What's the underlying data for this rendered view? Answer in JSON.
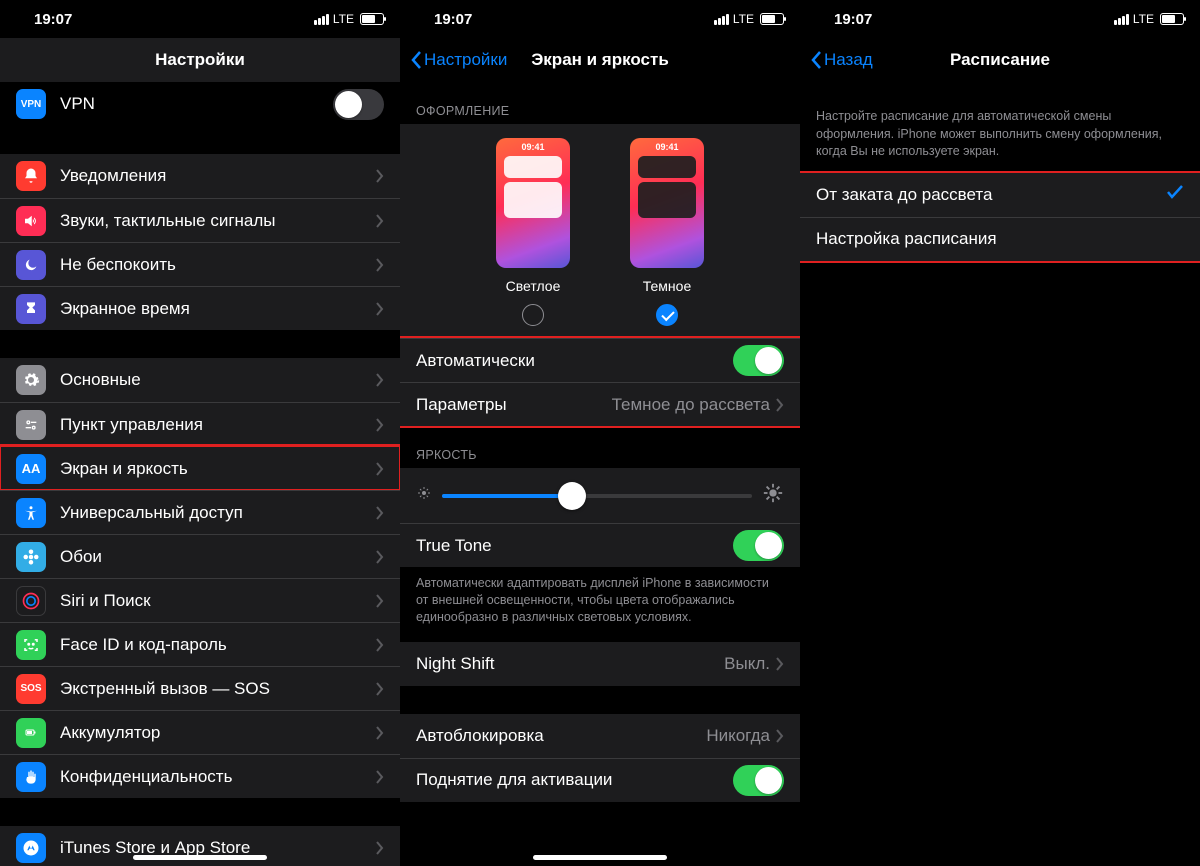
{
  "statusbar": {
    "time": "19:07",
    "network": "LTE"
  },
  "screen1": {
    "title": "Настройки",
    "vpn_label": "VPN",
    "items_g1": [
      {
        "label": "Уведомления",
        "icon": "bell",
        "bg": "#ff3b30"
      },
      {
        "label": "Звуки, тактильные сигналы",
        "icon": "sound",
        "bg": "#ff2d55"
      },
      {
        "label": "Не беспокоить",
        "icon": "moon",
        "bg": "#5856d6"
      },
      {
        "label": "Экранное время",
        "icon": "hourglass",
        "bg": "#5856d6"
      }
    ],
    "items_g2": [
      {
        "label": "Основные",
        "icon": "gear",
        "bg": "#8e8e93"
      },
      {
        "label": "Пункт управления",
        "icon": "switches",
        "bg": "#8e8e93"
      },
      {
        "label": "Экран и яркость",
        "icon": "AA",
        "bg": "#0a84ff",
        "hl": true
      },
      {
        "label": "Универсальный доступ",
        "icon": "person",
        "bg": "#0a84ff"
      },
      {
        "label": "Обои",
        "icon": "flower",
        "bg": "#32ade6"
      },
      {
        "label": "Siri и Поиск",
        "icon": "siri",
        "bg": "#1c1c1e"
      },
      {
        "label": "Face ID и код-пароль",
        "icon": "face",
        "bg": "#30d158"
      },
      {
        "label": "Экстренный вызов — SOS",
        "icon": "SOS",
        "bg": "#ff3b30"
      },
      {
        "label": "Аккумулятор",
        "icon": "battery",
        "bg": "#30d158"
      },
      {
        "label": "Конфиденциальность",
        "icon": "hand",
        "bg": "#0a84ff"
      }
    ],
    "items_g3": [
      {
        "label": "iTunes Store и App Store",
        "icon": "appstore",
        "bg": "#0a84ff"
      }
    ]
  },
  "screen2": {
    "back": "Настройки",
    "title": "Экран и яркость",
    "header_appearance": "ОФОРМЛЕНИЕ",
    "preview_time": "09:41",
    "light_label": "Светлое",
    "dark_label": "Темное",
    "auto_label": "Автоматически",
    "options_label": "Параметры",
    "options_value": "Темное до рассвета",
    "header_brightness": "ЯРКОСТЬ",
    "truetone_label": "True Tone",
    "truetone_footer": "Автоматически адаптировать дисплей iPhone в зависимости от внешней освещенности, чтобы цвета отображались единообразно в различных световых условиях.",
    "nightshift_label": "Night Shift",
    "nightshift_value": "Выкл.",
    "autolock_label": "Автоблокировка",
    "autolock_value": "Никогда",
    "raise_label": "Поднятие для активации"
  },
  "screen3": {
    "back": "Назад",
    "title": "Расписание",
    "intro": "Настройте расписание для автоматической смены оформления. iPhone может выполнить смену оформления, когда Вы не используете экран.",
    "opt1": "От заката до рассвета",
    "opt2": "Настройка расписания"
  }
}
